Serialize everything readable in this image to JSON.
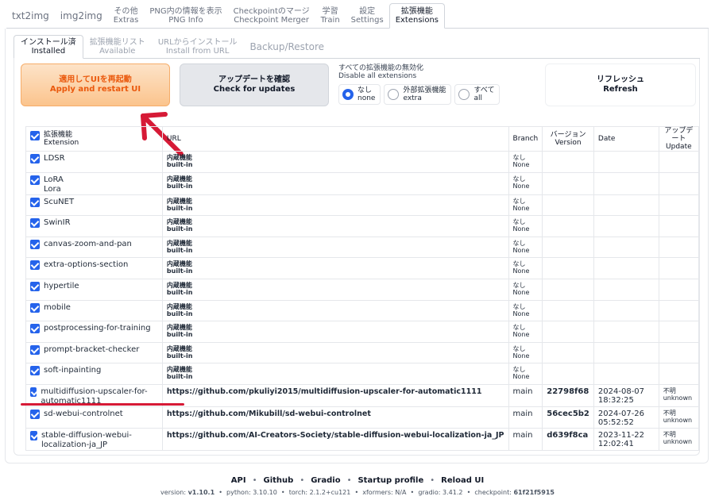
{
  "top_tabs": [
    {
      "one": "txt2img"
    },
    {
      "one": "img2img"
    },
    {
      "ja": "その他",
      "en": "Extras"
    },
    {
      "ja": "PNG内の情報を表示",
      "en": "PNG Info"
    },
    {
      "ja": "Checkpointのマージ",
      "en": "Checkpoint Merger"
    },
    {
      "ja": "学習",
      "en": "Train"
    },
    {
      "ja": "設定",
      "en": "Settings"
    },
    {
      "ja": "拡張機能",
      "en": "Extensions"
    }
  ],
  "sub_tabs": [
    {
      "ja": "インストール済",
      "en": "Installed"
    },
    {
      "ja": "拡張機能リスト",
      "en": "Available"
    },
    {
      "ja": "URLからインストール",
      "en": "Install from URL"
    },
    {
      "one": "Backup/Restore"
    }
  ],
  "buttons": {
    "apply": {
      "ja": "適用してUIを再起動",
      "en": "Apply and restart UI"
    },
    "check": {
      "ja": "アップデートを確認",
      "en": "Check for updates"
    },
    "refresh": {
      "ja": "リフレッシュ",
      "en": "Refresh"
    }
  },
  "disable": {
    "label_ja": "すべての拡張機能の無効化",
    "label_en": "Disable all extensions",
    "options": [
      {
        "ja": "なし",
        "en": "none",
        "selected": true
      },
      {
        "ja": "外部拡張機能",
        "en": "extra",
        "selected": false
      },
      {
        "ja": "すべて",
        "en": "all",
        "selected": false
      }
    ]
  },
  "table": {
    "headers": {
      "ext_ja": "拡張機能",
      "ext_en": "Extension",
      "url": "URL",
      "branch": "Branch",
      "version_ja": "バージョン",
      "version_en": "Version",
      "date": "Date",
      "update_ja": "アップデート",
      "update_en": "Update"
    },
    "rows": [
      {
        "name": "LDSR",
        "url_ja": "内蔵機能",
        "url_en": "built-in",
        "branch_ja": "なし",
        "branch_en": "None",
        "version": "",
        "date": "",
        "update_ja": "",
        "update_en": ""
      },
      {
        "name": "LoRA",
        "name2": "Lora",
        "url_ja": "内蔵機能",
        "url_en": "built-in",
        "branch_ja": "なし",
        "branch_en": "None",
        "version": "",
        "date": "",
        "update_ja": "",
        "update_en": ""
      },
      {
        "name": "ScuNET",
        "url_ja": "内蔵機能",
        "url_en": "built-in",
        "branch_ja": "なし",
        "branch_en": "None",
        "version": "",
        "date": "",
        "update_ja": "",
        "update_en": ""
      },
      {
        "name": "SwinIR",
        "url_ja": "内蔵機能",
        "url_en": "built-in",
        "branch_ja": "なし",
        "branch_en": "None",
        "version": "",
        "date": "",
        "update_ja": "",
        "update_en": ""
      },
      {
        "name": "canvas-zoom-and-pan",
        "url_ja": "内蔵機能",
        "url_en": "built-in",
        "branch_ja": "なし",
        "branch_en": "None",
        "version": "",
        "date": "",
        "update_ja": "",
        "update_en": ""
      },
      {
        "name": "extra-options-section",
        "url_ja": "内蔵機能",
        "url_en": "built-in",
        "branch_ja": "なし",
        "branch_en": "None",
        "version": "",
        "date": "",
        "update_ja": "",
        "update_en": ""
      },
      {
        "name": "hypertile",
        "url_ja": "内蔵機能",
        "url_en": "built-in",
        "branch_ja": "なし",
        "branch_en": "None",
        "version": "",
        "date": "",
        "update_ja": "",
        "update_en": ""
      },
      {
        "name": "mobile",
        "url_ja": "内蔵機能",
        "url_en": "built-in",
        "branch_ja": "なし",
        "branch_en": "None",
        "version": "",
        "date": "",
        "update_ja": "",
        "update_en": ""
      },
      {
        "name": "postprocessing-for-training",
        "url_ja": "内蔵機能",
        "url_en": "built-in",
        "branch_ja": "なし",
        "branch_en": "None",
        "version": "",
        "date": "",
        "update_ja": "",
        "update_en": ""
      },
      {
        "name": "prompt-bracket-checker",
        "url_ja": "内蔵機能",
        "url_en": "built-in",
        "branch_ja": "なし",
        "branch_en": "None",
        "version": "",
        "date": "",
        "update_ja": "",
        "update_en": ""
      },
      {
        "name": "soft-inpainting",
        "url_ja": "内蔵機能",
        "url_en": "built-in",
        "branch_ja": "なし",
        "branch_en": "None",
        "version": "",
        "date": "",
        "update_ja": "",
        "update_en": ""
      },
      {
        "name": "multidiffusion-upscaler-for-automatic1111",
        "url": "https://github.com/pkuliyi2015/multidiffusion-upscaler-for-automatic1111",
        "branch": "main",
        "version": "22798f68",
        "date": "2024-08-07 18:32:25",
        "update_ja": "不明",
        "update_en": "unknown"
      },
      {
        "name": "sd-webui-controlnet",
        "url": "https://github.com/Mikubill/sd-webui-controlnet",
        "branch": "main",
        "version": "56cec5b2",
        "date": "2024-07-26 05:52:52",
        "update_ja": "不明",
        "update_en": "unknown"
      },
      {
        "name": "stable-diffusion-webui-localization-ja_JP",
        "url": "https://github.com/AI-Creators-Society/stable-diffusion-webui-localization-ja_JP",
        "branch": "main",
        "version": "d639f8ca",
        "date": "2023-11-22 12:02:41",
        "update_ja": "不明",
        "update_en": "unknown"
      }
    ]
  },
  "footer": {
    "links": [
      "API",
      "Github",
      "Gradio",
      "Startup profile",
      "Reload UI"
    ],
    "version_label": "version:",
    "version": "v1.10.1",
    "python_label": "python:",
    "python": "3.10.10",
    "torch_label": "torch:",
    "torch": "2.1.2+cu121",
    "xformers_label": "xformers:",
    "xformers": "N/A",
    "gradio_label": "gradio:",
    "gradio": "3.41.2",
    "checkpoint_label": "checkpoint:",
    "checkpoint": "61f21f5915"
  },
  "colors": {
    "accent": "#2563eb",
    "annotation": "#d61a36",
    "apply_text": "#ea580c"
  }
}
